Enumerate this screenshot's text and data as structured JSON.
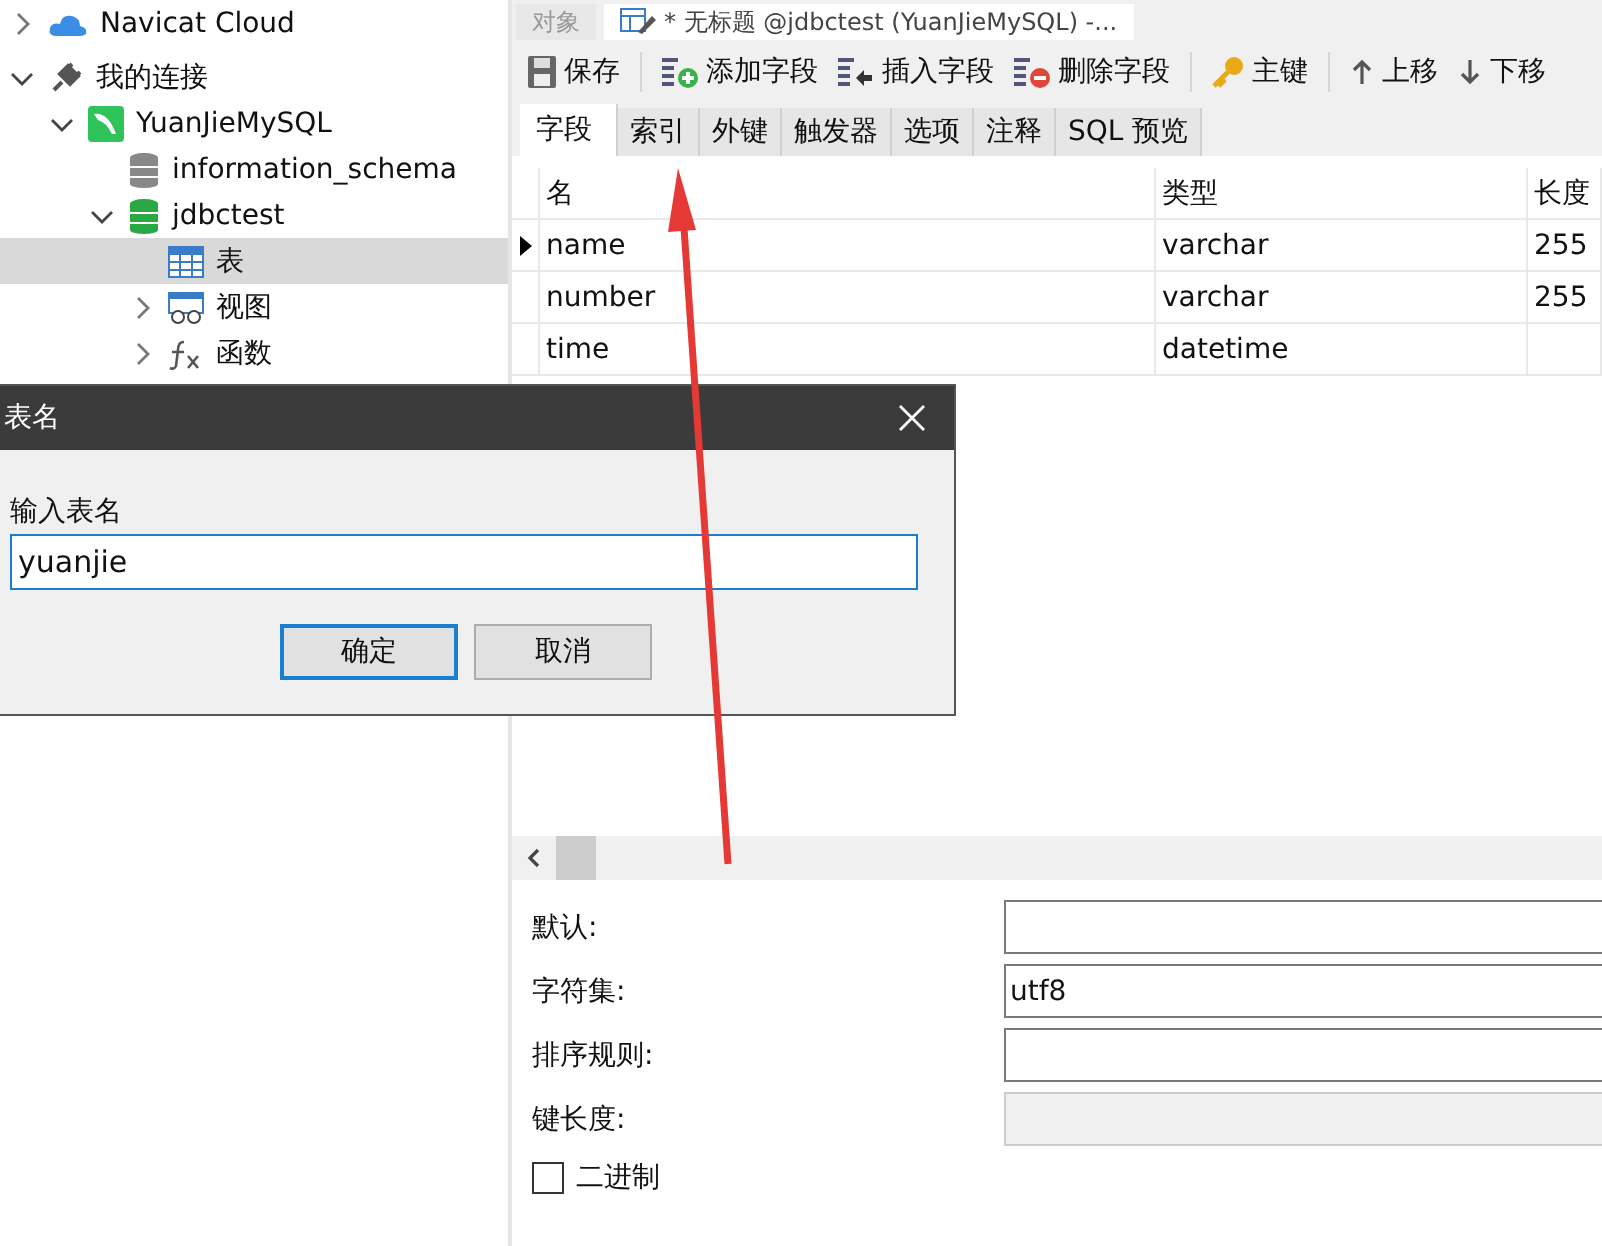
{
  "sidebar": {
    "items": [
      {
        "label": "Navicat Cloud",
        "kind": "cloud",
        "expanded": false
      },
      {
        "label": "我的连接",
        "kind": "group",
        "expanded": true,
        "children": [
          {
            "label": "YuanJieMySQL",
            "kind": "connection",
            "expanded": true,
            "children": [
              {
                "label": "information_schema",
                "kind": "database",
                "open": false
              },
              {
                "label": "jdbctest",
                "kind": "database",
                "open": true,
                "expanded": true,
                "children": [
                  {
                    "label": "表",
                    "kind": "tables",
                    "selected": true
                  },
                  {
                    "label": "视图",
                    "kind": "views",
                    "selected": false,
                    "expanded": false
                  },
                  {
                    "label": "函数",
                    "kind": "functions",
                    "selected": false,
                    "expanded": false
                  }
                ]
              }
            ]
          }
        ]
      }
    ]
  },
  "editor": {
    "tabs": [
      {
        "label": "对象",
        "selected": false
      },
      {
        "label": "* 无标题 @jdbctest (YuanJieMySQL) -...",
        "selected": true
      }
    ],
    "toolbar": [
      {
        "label": "保存",
        "kind": "save"
      },
      {
        "label": "添加字段",
        "kind": "add"
      },
      {
        "label": "插入字段",
        "kind": "insert"
      },
      {
        "label": "删除字段",
        "kind": "delete"
      },
      {
        "label": "主键",
        "kind": "key"
      },
      {
        "label": "上移",
        "kind": "up"
      },
      {
        "label": "下移",
        "kind": "down"
      }
    ],
    "subtabs": [
      {
        "label": "字段",
        "selected": true
      },
      {
        "label": "索引",
        "selected": false
      },
      {
        "label": "外键",
        "selected": false
      },
      {
        "label": "触发器",
        "selected": false
      },
      {
        "label": "选项",
        "selected": false
      },
      {
        "label": "注释",
        "selected": false
      },
      {
        "label": "SQL 预览",
        "selected": false
      }
    ],
    "table": {
      "columns": [
        "名",
        "类型",
        "长度"
      ],
      "rows": [
        {
          "cells": [
            "name",
            "varchar",
            "255"
          ],
          "current": true
        },
        {
          "cells": [
            "number",
            "varchar",
            "255"
          ],
          "current": false
        },
        {
          "cells": [
            "time",
            "datetime",
            ""
          ],
          "current": false
        }
      ]
    },
    "properties": [
      {
        "label": "默认:",
        "disabled": false
      },
      {
        "label": "字符集:",
        "value": "utf8",
        "disabled": false
      },
      {
        "label": "排序规则:",
        "disabled": false
      },
      {
        "label": "键长度:",
        "disabled": true
      }
    ],
    "binary": {
      "label": "二进制",
      "checked": false
    }
  },
  "dialog": {
    "title": "表名",
    "prompt": "输入表名",
    "value": "yuanjie",
    "buttons": [
      {
        "label": "确定",
        "default": true
      },
      {
        "label": "取消",
        "default": false
      }
    ]
  }
}
